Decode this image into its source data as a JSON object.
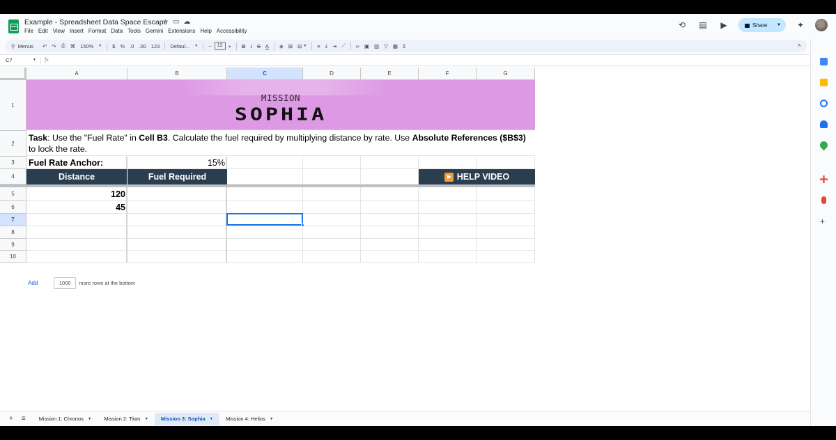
{
  "doc": {
    "title": "Example - Spreadsheet Data Space Escape",
    "menu": [
      "File",
      "Edit",
      "View",
      "Insert",
      "Format",
      "Data",
      "Tools",
      "Gemini",
      "Extensions",
      "Help",
      "Accessibility"
    ],
    "share_label": "Share"
  },
  "toolbar": {
    "menus_label": "Menus",
    "zoom": "150%",
    "currency": "$",
    "percent": "%",
    "decrease_decimal": ".0",
    "increase_decimal": ".00",
    "number_format": "123",
    "font_name": "Defaul...",
    "font_size": "12",
    "bold": "B",
    "italic": "I",
    "strike": "S",
    "text_color": "A",
    "sigma": "Σ"
  },
  "formula_bar": {
    "name_box": "C7",
    "fx": "fx",
    "value": ""
  },
  "grid": {
    "columns": [
      "A",
      "B",
      "C",
      "D",
      "E",
      "F",
      "G"
    ],
    "selected_column": "C",
    "rows": [
      "1",
      "2",
      "3",
      "4",
      "5",
      "6",
      "7",
      "8",
      "9",
      "10"
    ],
    "selected_row": "7",
    "selected_cell": "C7"
  },
  "sheet": {
    "banner_top": "MISSION",
    "banner_name": "SOPHIA",
    "task": {
      "label": "Task",
      "text1": ": Use the \"Fuel Rate\" in ",
      "cell_ref": "Cell B3",
      "text2": ". Calculate the fuel required by multiplying distance by rate. Use ",
      "abs_ref": "Absolute References ($B$3)",
      "text3": " to lock the rate."
    },
    "anchor_label": "Fuel Rate Anchor:",
    "anchor_value": "15%",
    "header_distance": "Distance",
    "header_fuel": "Fuel Required",
    "help_video": "HELP VIDEO",
    "distances": [
      "120",
      "45"
    ]
  },
  "add_rows": {
    "link": "Add",
    "count": "1000",
    "suffix": "more rows at the bottom"
  },
  "tabs": [
    {
      "label": "Mission 1: Chronos",
      "active": false
    },
    {
      "label": "Mission 2: Titan",
      "active": false
    },
    {
      "label": "Mission 3: Sophia",
      "active": true
    },
    {
      "label": "Mission 4: Helios",
      "active": false
    }
  ],
  "colors": {
    "banner": "#dd99e4",
    "header_dark": "#2b3e50",
    "help_play": "#f19a3e",
    "selection": "#1a73e8",
    "share_button": "#c2e7ff"
  }
}
